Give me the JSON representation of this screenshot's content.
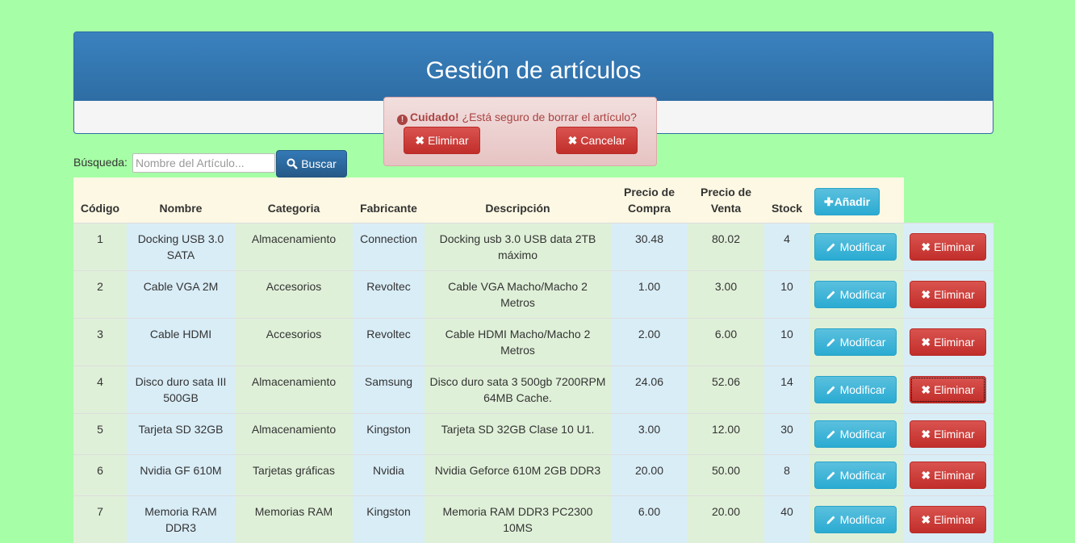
{
  "header": {
    "title": "Gestión de artículos"
  },
  "alert": {
    "strong": "Cuidado!",
    "message": "¿Está seguro de borrar el artículo?",
    "confirm_label": "Eliminar",
    "cancel_label": "Cancelar"
  },
  "search": {
    "label": "Búsqueda:",
    "placeholder": "Nombre del Artículo...",
    "button_label": "Buscar"
  },
  "table": {
    "headers": {
      "codigo": "Código",
      "nombre": "Nombre",
      "categoria": "Categoria",
      "fabricante": "Fabricante",
      "descripcion": "Descripción",
      "precio_compra_1": "Precio de",
      "precio_compra_2": "Compra",
      "precio_venta_1": "Precio de",
      "precio_venta_2": "Venta",
      "stock": "Stock",
      "add_label": "Añadir"
    },
    "modify_label": "Modificar",
    "delete_label": "Eliminar",
    "rows": [
      {
        "codigo": "1",
        "nombre": "Docking USB 3.0 SATA",
        "categoria": "Almacenamiento",
        "fabricante": "Connection",
        "descripcion": "Docking usb 3.0 USB data 2TB máximo",
        "compra": "30.48",
        "venta": "80.02",
        "stock": "4"
      },
      {
        "codigo": "2",
        "nombre": "Cable VGA 2M",
        "categoria": "Accesorios",
        "fabricante": "Revoltec",
        "descripcion": "Cable VGA Macho/Macho 2 Metros",
        "compra": "1.00",
        "venta": "3.00",
        "stock": "10"
      },
      {
        "codigo": "3",
        "nombre": "Cable HDMI",
        "categoria": "Accesorios",
        "fabricante": "Revoltec",
        "descripcion": "Cable HDMI Macho/Macho 2 Metros",
        "compra": "2.00",
        "venta": "6.00",
        "stock": "10"
      },
      {
        "codigo": "4",
        "nombre": "Disco duro sata III 500GB",
        "categoria": "Almacenamiento",
        "fabricante": "Samsung",
        "descripcion": "Disco duro sata 3 500gb 7200RPM 64MB Cache.",
        "compra": "24.06",
        "venta": "52.06",
        "stock": "14"
      },
      {
        "codigo": "5",
        "nombre": "Tarjeta SD 32GB",
        "categoria": "Almacenamiento",
        "fabricante": "Kingston",
        "descripcion": "Tarjeta SD 32GB Clase 10 U1.",
        "compra": "3.00",
        "venta": "12.00",
        "stock": "30"
      },
      {
        "codigo": "6",
        "nombre": "Nvidia GF 610M",
        "categoria": "Tarjetas gráficas",
        "fabricante": "Nvidia",
        "descripcion": "Nvidia Geforce 610M 2GB DDR3",
        "compra": "20.00",
        "venta": "50.00",
        "stock": "8"
      },
      {
        "codigo": "7",
        "nombre": "Memoria RAM DDR3",
        "categoria": "Memorias RAM",
        "fabricante": "Kingston",
        "descripcion": "Memoria RAM DDR3 PC2300 10MS",
        "compra": "6.00",
        "venta": "20.00",
        "stock": "40"
      }
    ]
  }
}
